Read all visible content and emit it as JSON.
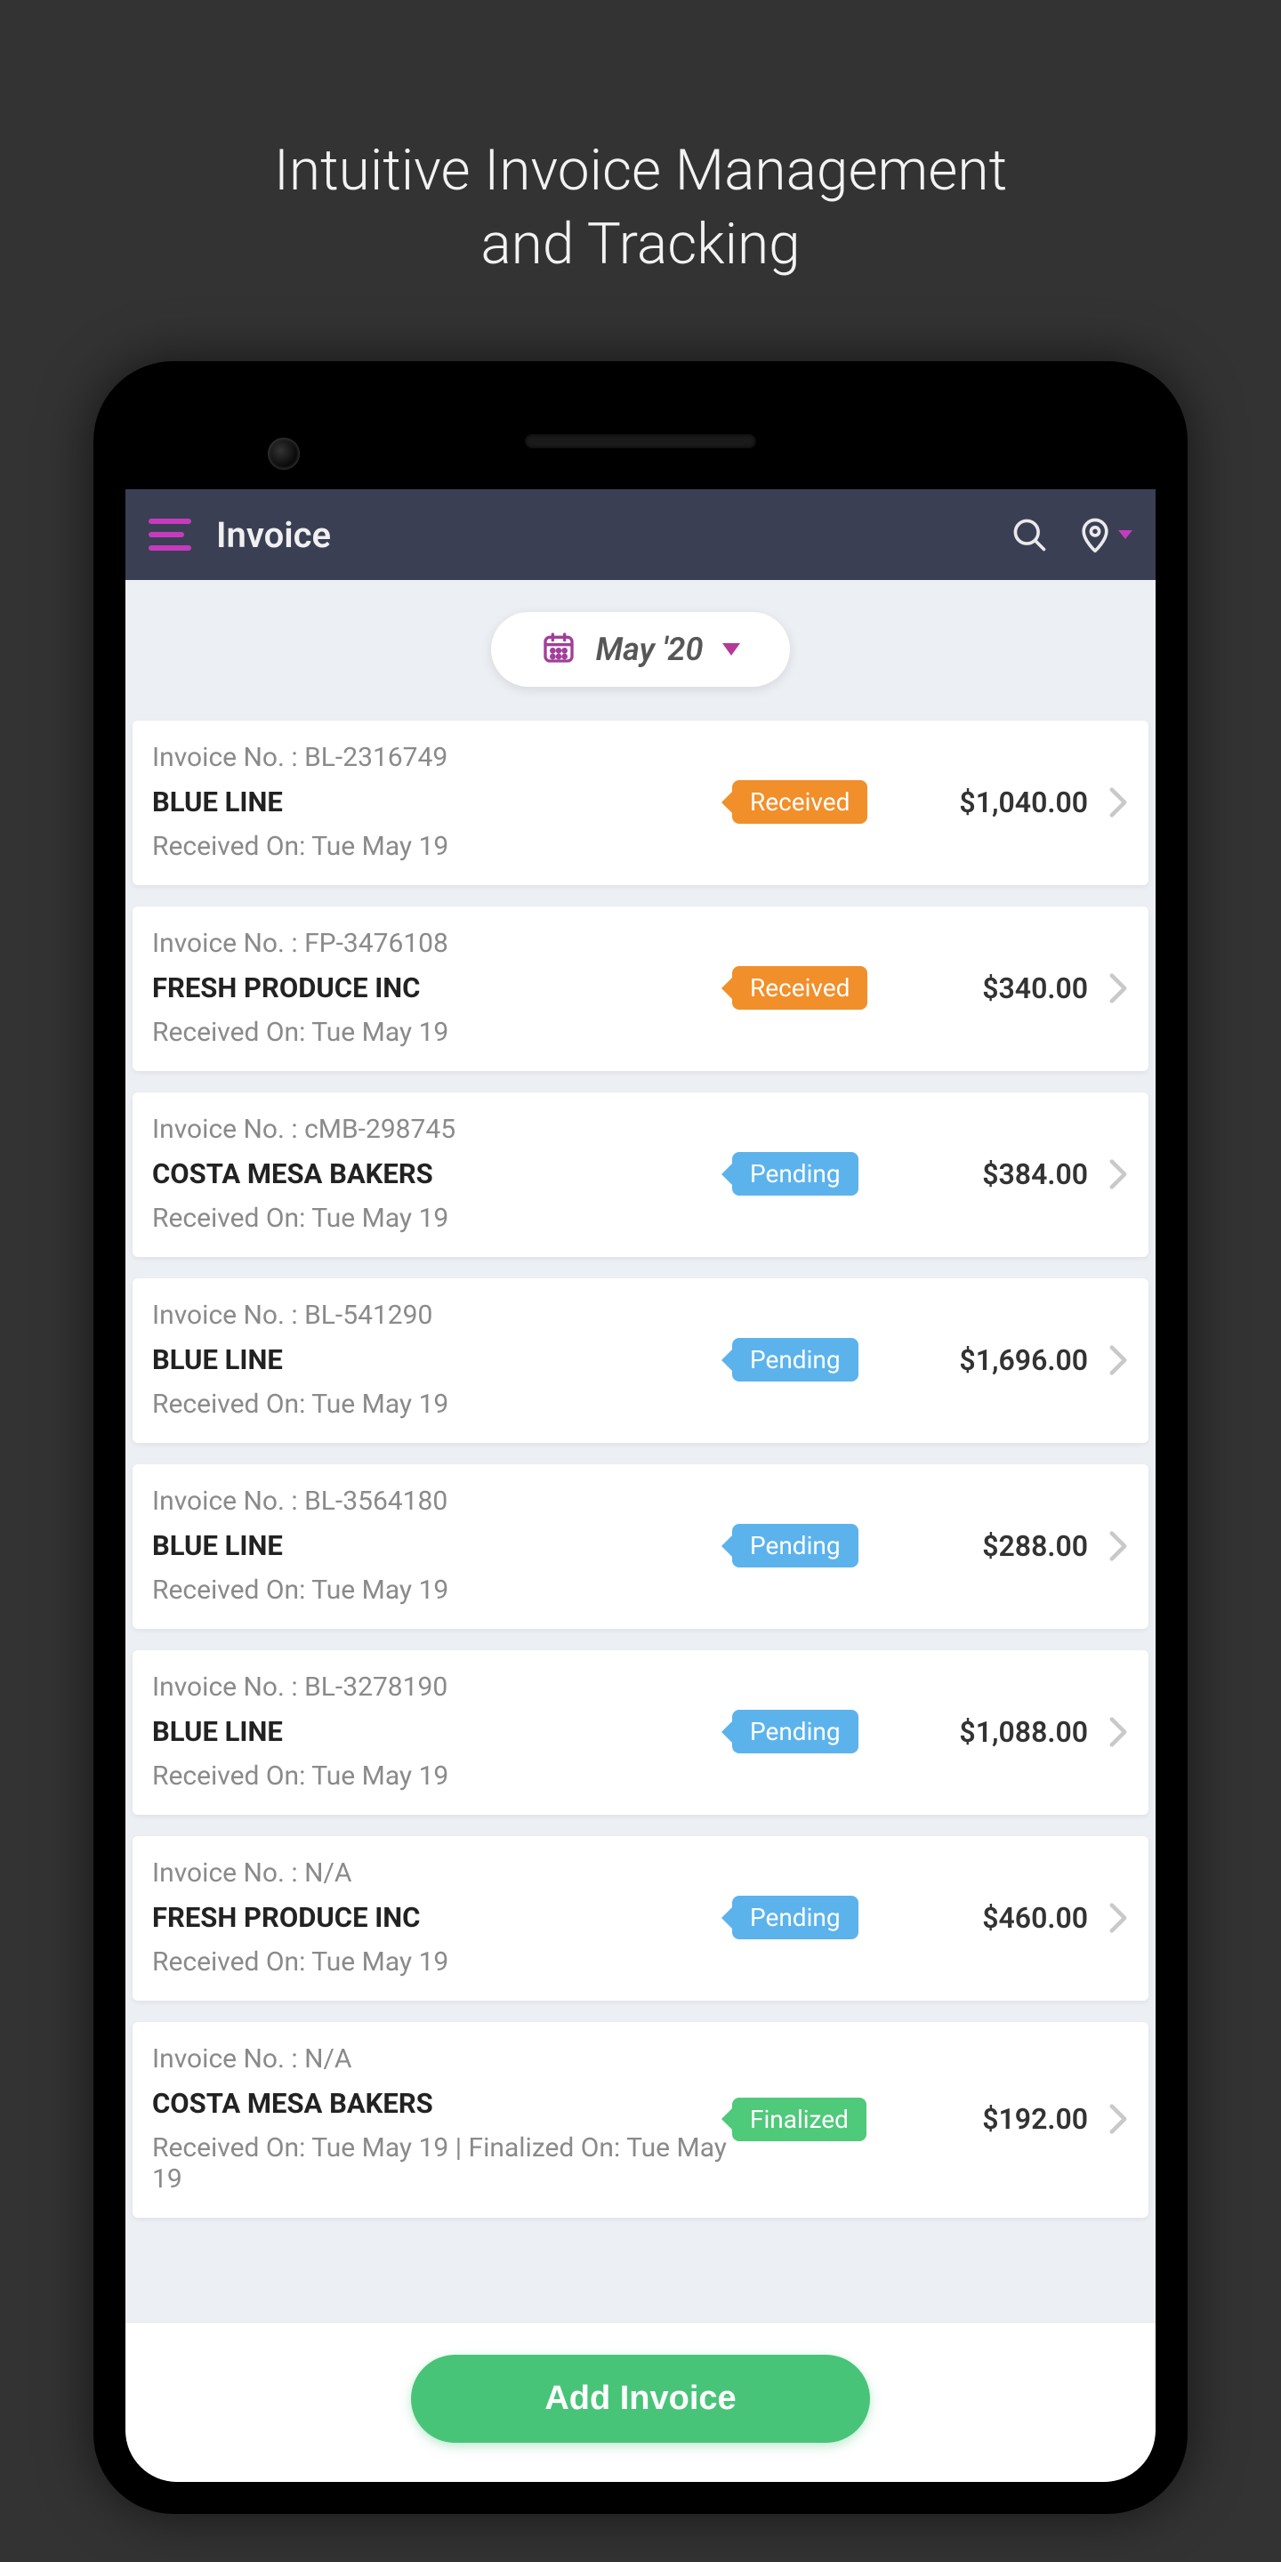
{
  "promo": {
    "line1": "Intuitive Invoice Management",
    "line2": "and Tracking"
  },
  "header": {
    "title": "Invoice"
  },
  "date_filter": {
    "label": "May '20"
  },
  "labels": {
    "invoice_no_prefix": "Invoice No. : ",
    "received_on_prefix": "Received On: ",
    "finalized_on_prefix": " | Finalized On: "
  },
  "status_labels": {
    "received": "Received",
    "pending": "Pending",
    "finalized": "Finalized"
  },
  "invoices": [
    {
      "number": "BL-2316749",
      "vendor": "BLUE LINE",
      "status": "received",
      "amount": "$1,040.00",
      "received_on": "Tue May 19",
      "finalized_on": null
    },
    {
      "number": "FP-3476108",
      "vendor": "FRESH PRODUCE INC",
      "status": "received",
      "amount": "$340.00",
      "received_on": "Tue May 19",
      "finalized_on": null
    },
    {
      "number": "cMB-298745",
      "vendor": "COSTA MESA BAKERS",
      "status": "pending",
      "amount": "$384.00",
      "received_on": "Tue May 19",
      "finalized_on": null
    },
    {
      "number": "BL-541290",
      "vendor": "BLUE LINE",
      "status": "pending",
      "amount": "$1,696.00",
      "received_on": "Tue May 19",
      "finalized_on": null
    },
    {
      "number": "BL-3564180",
      "vendor": "BLUE LINE",
      "status": "pending",
      "amount": "$288.00",
      "received_on": "Tue May 19",
      "finalized_on": null
    },
    {
      "number": "BL-3278190",
      "vendor": "BLUE LINE",
      "status": "pending",
      "amount": "$1,088.00",
      "received_on": "Tue May 19",
      "finalized_on": null
    },
    {
      "number": "N/A",
      "vendor": "FRESH PRODUCE INC",
      "status": "pending",
      "amount": "$460.00",
      "received_on": "Tue May 19",
      "finalized_on": null
    },
    {
      "number": "N/A",
      "vendor": "COSTA MESA BAKERS",
      "status": "finalized",
      "amount": "$192.00",
      "received_on": "Tue May 19",
      "finalized_on": "Tue May 19"
    }
  ],
  "actions": {
    "add_invoice": "Add Invoice"
  }
}
